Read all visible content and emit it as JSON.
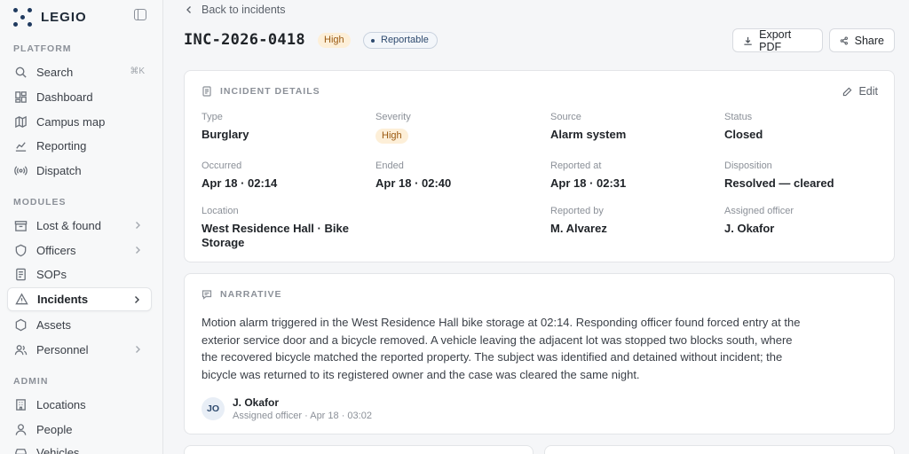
{
  "brand": {
    "name": "LEGIO"
  },
  "sidebar": {
    "platform_label": "PLATFORM",
    "search": {
      "label": "Search",
      "shortcut": "⌘K"
    },
    "platform_items": [
      {
        "label": "Dashboard",
        "icon": "dashboard-icon"
      },
      {
        "label": "Campus map",
        "icon": "map-icon"
      },
      {
        "label": "Reporting",
        "icon": "chart-line-icon"
      },
      {
        "label": "Dispatch",
        "icon": "radio-icon"
      }
    ],
    "modules_label": "MODULES",
    "module_items": [
      {
        "label": "Lost & found",
        "icon": "box-icon",
        "has_children": true
      },
      {
        "label": "Officers",
        "icon": "shield-icon",
        "has_children": true
      },
      {
        "label": "SOPs",
        "icon": "document-icon",
        "has_children": false
      },
      {
        "label": "Incidents",
        "icon": "alert-triangle-icon",
        "has_children": true,
        "active": true
      },
      {
        "label": "Assets",
        "icon": "hexagon-icon",
        "has_children": false
      },
      {
        "label": "Personnel",
        "icon": "users-icon",
        "has_children": true
      }
    ],
    "admin_label": "ADMIN",
    "admin_items": [
      {
        "label": "Locations",
        "icon": "building-icon"
      },
      {
        "label": "People",
        "icon": "user-icon"
      },
      {
        "label": "Vehicles",
        "icon": "car-icon"
      }
    ]
  },
  "header": {
    "back_label": "Back to incidents",
    "incident_id": "INC-2026-0418",
    "severity_badge": "High",
    "reportable_badge": "Reportable",
    "export_label": "Export PDF",
    "share_label": "Share"
  },
  "details": {
    "title": "INCIDENT DETAILS",
    "edit_label": "Edit",
    "type": {
      "label": "Type",
      "value": "Burglary"
    },
    "severity": {
      "label": "Severity",
      "value": "High"
    },
    "source": {
      "label": "Source",
      "value": "Alarm system"
    },
    "status": {
      "label": "Status",
      "value": "Closed"
    },
    "occurred": {
      "label": "Occurred",
      "value": "Apr 18 · 02:14"
    },
    "ended": {
      "label": "Ended",
      "value": "Apr 18 · 02:40"
    },
    "reported_at": {
      "label": "Reported at",
      "value": "Apr 18 · 02:31"
    },
    "disposition": {
      "label": "Disposition",
      "value": "Resolved — cleared"
    },
    "location": {
      "label": "Location",
      "value": "West Residence Hall · Bike Storage"
    },
    "reported_by": {
      "label": "Reported by",
      "value": "M. Alvarez"
    },
    "assigned_officer": {
      "label": "Assigned officer",
      "value": "J. Okafor"
    }
  },
  "narrative": {
    "title": "NARRATIVE",
    "text": "Motion alarm triggered in the West Residence Hall bike storage at 02:14. Responding officer found forced entry at the exterior service door and a bicycle removed. A vehicle leaving the adjacent lot was stopped two blocks south, where the recovered bicycle matched the reported property. The subject was identified and detained without incident; the bicycle was returned to its registered owner and the case was cleared the same night.",
    "author_initials": "JO",
    "author_name": "J. Okafor",
    "author_meta": "Assigned officer · Apr 18 · 03:02"
  },
  "colors": {
    "accent": "#1f3a5f",
    "high_badge_bg": "#fdefd8",
    "high_badge_text": "#9a5a12"
  }
}
